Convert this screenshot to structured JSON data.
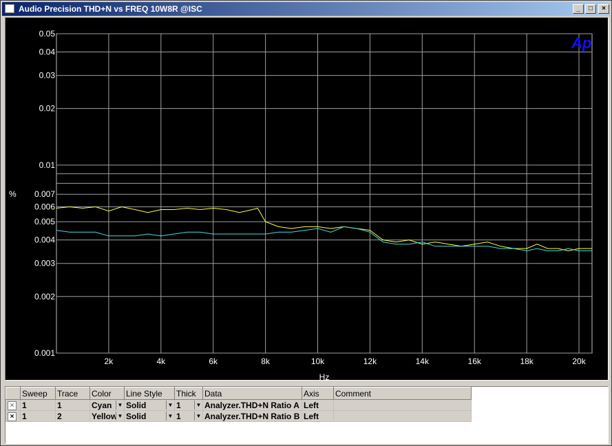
{
  "window": {
    "title": "Audio Precision  THD+N vs FREQ 10W8R @ISC",
    "buttons": {
      "minimize": "_",
      "maximize": "□",
      "close": "×"
    }
  },
  "chart_data": {
    "type": "line",
    "xlabel": "Hz",
    "ylabel": "%",
    "xlim": [
      0,
      20500
    ],
    "ylim": [
      0.001,
      0.05
    ],
    "yscale": "log",
    "grid": true,
    "logo": "Ap",
    "x_ticks": [
      2000,
      4000,
      6000,
      8000,
      10000,
      12000,
      14000,
      16000,
      18000,
      20000
    ],
    "x_tick_labels": [
      "2k",
      "4k",
      "6k",
      "8k",
      "10k",
      "12k",
      "14k",
      "16k",
      "18k",
      "20k"
    ],
    "y_ticks": [
      0.001,
      0.002,
      0.003,
      0.004,
      0.005,
      0.006,
      0.007,
      0.01,
      0.02,
      0.03,
      0.04,
      0.05
    ],
    "y_tick_labels": [
      "0.001",
      "0.002",
      "0.003",
      "0.004",
      "0.005",
      "0.006",
      "0.007",
      "0.01",
      "0.02",
      "0.03",
      "0.04",
      "0.05"
    ],
    "y_minor_grid": [
      0.008,
      0.009
    ],
    "series": [
      {
        "color": "#ffff40",
        "x": [
          0,
          500,
          1000,
          1500,
          2000,
          2500,
          3000,
          3500,
          4000,
          4500,
          5000,
          5500,
          6000,
          6500,
          7000,
          7500,
          7700,
          8000,
          8500,
          9000,
          9500,
          10000,
          10500,
          11000,
          11500,
          12000,
          12500,
          13000,
          13500,
          14000,
          14500,
          15000,
          15500,
          16000,
          16500,
          17000,
          17500,
          18000,
          18400,
          18800,
          19200,
          19600,
          20000,
          20500
        ],
        "y": [
          0.0059,
          0.006,
          0.0059,
          0.006,
          0.0057,
          0.006,
          0.0058,
          0.0056,
          0.0058,
          0.0058,
          0.0059,
          0.0058,
          0.0059,
          0.0058,
          0.0056,
          0.0058,
          0.0059,
          0.005,
          0.0047,
          0.0046,
          0.0047,
          0.0047,
          0.0046,
          0.0047,
          0.0046,
          0.0045,
          0.004,
          0.0039,
          0.004,
          0.0038,
          0.0039,
          0.0038,
          0.0037,
          0.0038,
          0.0039,
          0.0037,
          0.0036,
          0.0036,
          0.0038,
          0.0036,
          0.0036,
          0.0035,
          0.0036,
          0.0036
        ]
      },
      {
        "color": "#40e0e0",
        "x": [
          0,
          500,
          1000,
          1500,
          2000,
          2500,
          3000,
          3500,
          4000,
          4500,
          5000,
          5500,
          6000,
          6500,
          7000,
          7500,
          8000,
          8500,
          9000,
          9500,
          10000,
          10500,
          11000,
          11500,
          12000,
          12500,
          13000,
          13500,
          14000,
          14500,
          15000,
          15500,
          16000,
          16500,
          17000,
          17500,
          18000,
          18400,
          18800,
          19200,
          19600,
          20000,
          20500
        ],
        "y": [
          0.0045,
          0.0044,
          0.0044,
          0.0044,
          0.0042,
          0.0042,
          0.0042,
          0.0043,
          0.0042,
          0.0043,
          0.0044,
          0.0044,
          0.0043,
          0.0043,
          0.0043,
          0.0043,
          0.0043,
          0.0044,
          0.0044,
          0.0045,
          0.0046,
          0.0044,
          0.0047,
          0.0046,
          0.0044,
          0.0039,
          0.0038,
          0.0038,
          0.0039,
          0.0037,
          0.0037,
          0.0037,
          0.0037,
          0.0037,
          0.0036,
          0.0036,
          0.0035,
          0.0036,
          0.0035,
          0.0035,
          0.0036,
          0.0035,
          0.0035
        ]
      }
    ]
  },
  "table": {
    "headers": [
      "",
      "Sweep",
      "Trace",
      "Color",
      "Line Style",
      "Thick",
      "Data",
      "Axis",
      "Comment"
    ],
    "rows": [
      {
        "check": "×",
        "sweep": "1",
        "trace": "1",
        "color": "Cyan",
        "linestyle": "Solid",
        "thick": "1",
        "data": "Analyzer.THD+N Ratio A",
        "axis": "Left",
        "comment": ""
      },
      {
        "check": "×",
        "sweep": "1",
        "trace": "2",
        "color": "Yellow",
        "linestyle": "Solid",
        "thick": "1",
        "data": "Analyzer.THD+N Ratio B",
        "axis": "Left",
        "comment": ""
      }
    ],
    "dropdown_icon": "▼"
  }
}
